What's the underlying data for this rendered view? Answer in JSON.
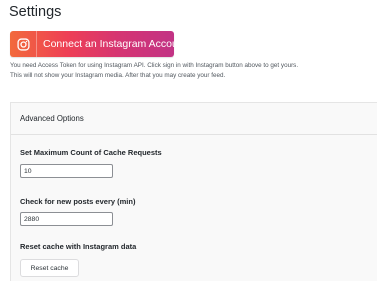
{
  "page": {
    "title": "Settings"
  },
  "connect": {
    "button_label": "Connect an Instagram Account",
    "icon": "instagram-icon",
    "gradient_colors": [
      "#f26a3c",
      "#ee3f55",
      "#d63571",
      "#c23385"
    ]
  },
  "notice": {
    "line1": "You need Access Token for using Instagram API. Click sign in with Instagram button above to get yours.",
    "line2": "This will not show your Instagram media. After that you may create your feed."
  },
  "advanced": {
    "title": "Advanced Options",
    "cache_requests": {
      "label": "Set Maximum Count of Cache Requests",
      "value": "10"
    },
    "check_interval": {
      "label": "Check for new posts every (min)",
      "value": "2880"
    },
    "reset": {
      "label": "Reset cache with Instagram data",
      "button_label": "Reset cache"
    }
  }
}
